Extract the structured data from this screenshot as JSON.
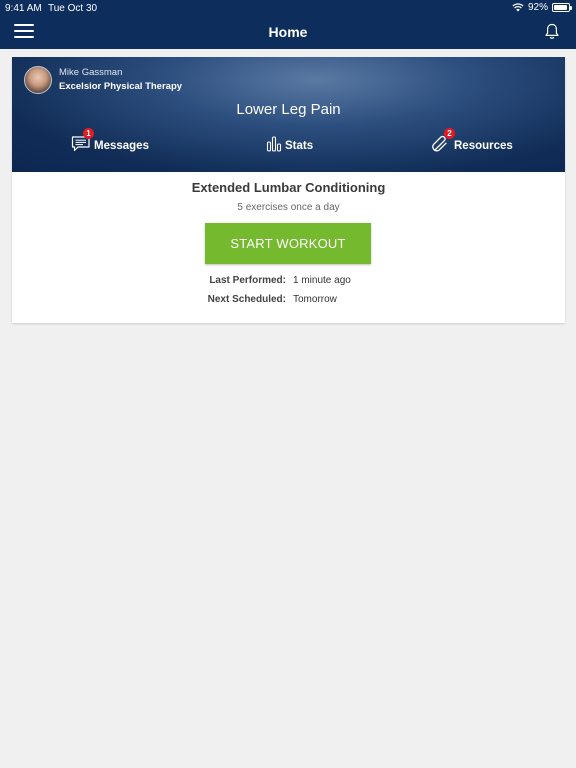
{
  "status_bar": {
    "time": "9:41 AM",
    "date": "Tue Oct 30",
    "battery_text": "92%",
    "battery_level": 0.92
  },
  "nav": {
    "title": "Home",
    "menu_icon": "hamburger-icon",
    "notification_icon": "bell-icon"
  },
  "profile": {
    "therapist_name": "Mike Gassman",
    "clinic_name": "Excelsior Physical Therapy",
    "condition": "Lower Leg Pain"
  },
  "hero_links": {
    "messages": {
      "label": "Messages",
      "badge": "1",
      "icon": "chat-icon"
    },
    "stats": {
      "label": "Stats",
      "icon": "bar-chart-icon"
    },
    "resources": {
      "label": "Resources",
      "badge": "2",
      "icon": "paperclip-icon"
    }
  },
  "workout": {
    "title": "Extended Lumbar Conditioning",
    "subtitle": "5 exercises once a day",
    "start_label": "START WORKOUT",
    "last_performed_label": "Last Performed:",
    "last_performed_value": "1 minute ago",
    "next_scheduled_label": "Next Scheduled:",
    "next_scheduled_value": "Tomorrow"
  },
  "colors": {
    "nav_bg": "#0d2d5c",
    "start_button": "#74b92e",
    "badge": "#e21b23",
    "page_bg": "#f0f0f0"
  }
}
